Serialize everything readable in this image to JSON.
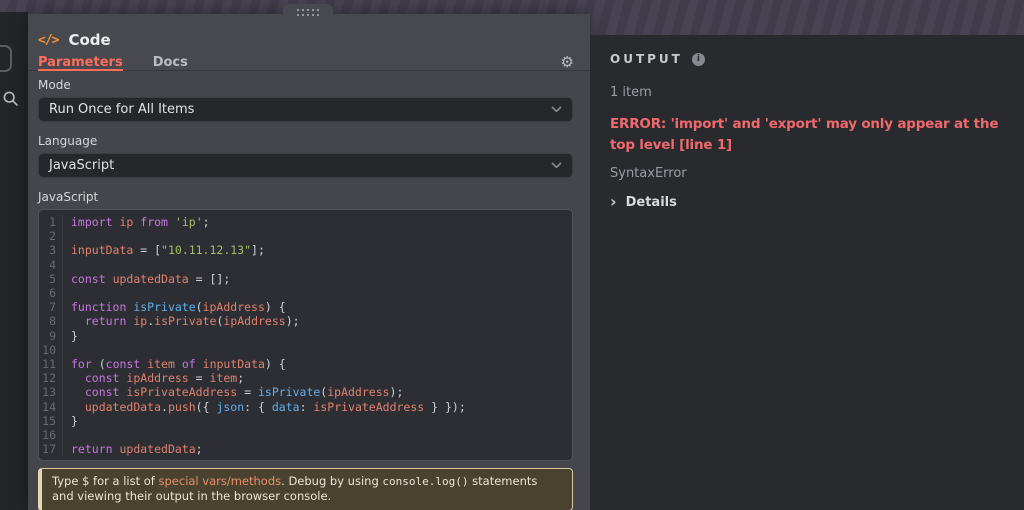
{
  "dialog": {
    "title": "Code",
    "tabs": [
      {
        "label": "Parameters",
        "active": true
      },
      {
        "label": "Docs",
        "active": false
      }
    ],
    "fields": {
      "mode": {
        "label": "Mode",
        "value": "Run Once for All Items"
      },
      "language": {
        "label": "Language",
        "value": "JavaScript"
      },
      "editor_label": "JavaScript"
    },
    "hint": {
      "parts": [
        [
          "t",
          "Type $ for a list of "
        ],
        [
          "lnk",
          "special vars/methods"
        ],
        [
          "t",
          ". Debug by using "
        ],
        [
          "cd",
          "console.log()"
        ],
        [
          "t",
          " statements and viewing their output in the browser console."
        ]
      ]
    }
  },
  "code": {
    "lines": [
      {
        "tokens": [
          [
            "kw",
            "import"
          ],
          [
            "pl",
            " "
          ],
          [
            "vr",
            "ip"
          ],
          [
            "pl",
            " "
          ],
          [
            "kw",
            "from"
          ],
          [
            "pl",
            " "
          ],
          [
            "st",
            "'ip'"
          ],
          [
            "pl",
            ";"
          ]
        ]
      },
      {
        "tokens": []
      },
      {
        "tokens": [
          [
            "vr",
            "inputData"
          ],
          [
            "pl",
            " = ["
          ],
          [
            "st",
            "\"10.11.12.13\""
          ],
          [
            "pl",
            "];"
          ]
        ]
      },
      {
        "tokens": []
      },
      {
        "tokens": [
          [
            "kw",
            "const"
          ],
          [
            "pl",
            " "
          ],
          [
            "vr",
            "updatedData"
          ],
          [
            "pl",
            " = [];"
          ]
        ]
      },
      {
        "tokens": []
      },
      {
        "tokens": [
          [
            "kw",
            "function"
          ],
          [
            "pl",
            " "
          ],
          [
            "fn",
            "isPrivate"
          ],
          [
            "pl",
            "("
          ],
          [
            "vr",
            "ipAddress"
          ],
          [
            "pl",
            ") {"
          ]
        ]
      },
      {
        "tokens": [
          [
            "pl",
            "  "
          ],
          [
            "kw",
            "return"
          ],
          [
            "pl",
            " "
          ],
          [
            "vr",
            "ip"
          ],
          [
            "pl",
            "."
          ],
          [
            "vr",
            "isPrivate"
          ],
          [
            "pl",
            "("
          ],
          [
            "vr",
            "ipAddress"
          ],
          [
            "pl",
            ");"
          ]
        ]
      },
      {
        "tokens": [
          [
            "pl",
            "}"
          ]
        ]
      },
      {
        "tokens": []
      },
      {
        "tokens": [
          [
            "kw",
            "for"
          ],
          [
            "pl",
            " ("
          ],
          [
            "kw",
            "const"
          ],
          [
            "pl",
            " "
          ],
          [
            "vr",
            "item"
          ],
          [
            "pl",
            " "
          ],
          [
            "kw",
            "of"
          ],
          [
            "pl",
            " "
          ],
          [
            "vr",
            "inputData"
          ],
          [
            "pl",
            ") {"
          ]
        ]
      },
      {
        "tokens": [
          [
            "pl",
            "  "
          ],
          [
            "kw",
            "const"
          ],
          [
            "pl",
            " "
          ],
          [
            "vr",
            "ipAddress"
          ],
          [
            "pl",
            " = "
          ],
          [
            "vr",
            "item"
          ],
          [
            "pl",
            ";"
          ]
        ]
      },
      {
        "tokens": [
          [
            "pl",
            "  "
          ],
          [
            "kw",
            "const"
          ],
          [
            "pl",
            " "
          ],
          [
            "vr",
            "isPrivateAddress"
          ],
          [
            "pl",
            " = "
          ],
          [
            "fn",
            "isPrivate"
          ],
          [
            "pl",
            "("
          ],
          [
            "vr",
            "ipAddress"
          ],
          [
            "pl",
            ");"
          ]
        ]
      },
      {
        "tokens": [
          [
            "pl",
            "  "
          ],
          [
            "vr",
            "updatedData"
          ],
          [
            "pl",
            "."
          ],
          [
            "vr",
            "push"
          ],
          [
            "pl",
            "({ "
          ],
          [
            "fn",
            "json"
          ],
          [
            "pl",
            ": { "
          ],
          [
            "fn",
            "data"
          ],
          [
            "pl",
            ": "
          ],
          [
            "vr",
            "isPrivateAddress"
          ],
          [
            "pl",
            " } });"
          ]
        ]
      },
      {
        "tokens": [
          [
            "pl",
            "}"
          ]
        ]
      },
      {
        "tokens": []
      },
      {
        "tokens": [
          [
            "kw",
            "return"
          ],
          [
            "pl",
            " "
          ],
          [
            "vr",
            "updatedData"
          ],
          [
            "pl",
            ";"
          ]
        ]
      }
    ]
  },
  "output": {
    "title": "OUTPUT",
    "items_count": "1 item",
    "error": "ERROR: 'import' and 'export' may only appear at the top level [line 1]",
    "error_type": "SyntaxError",
    "details_label": "Details"
  },
  "colors": {
    "accent_orange": "#ff6d5a",
    "node_icon_orange": "#f0913e",
    "error_red": "#f06a6d",
    "hint_border_tan": "#e7d8ae",
    "hint_link": "#e88f6d",
    "token_keyword": "#c678dd",
    "token_variable": "#e0826e",
    "token_string": "#a4bd68",
    "token_function": "#61afef"
  }
}
